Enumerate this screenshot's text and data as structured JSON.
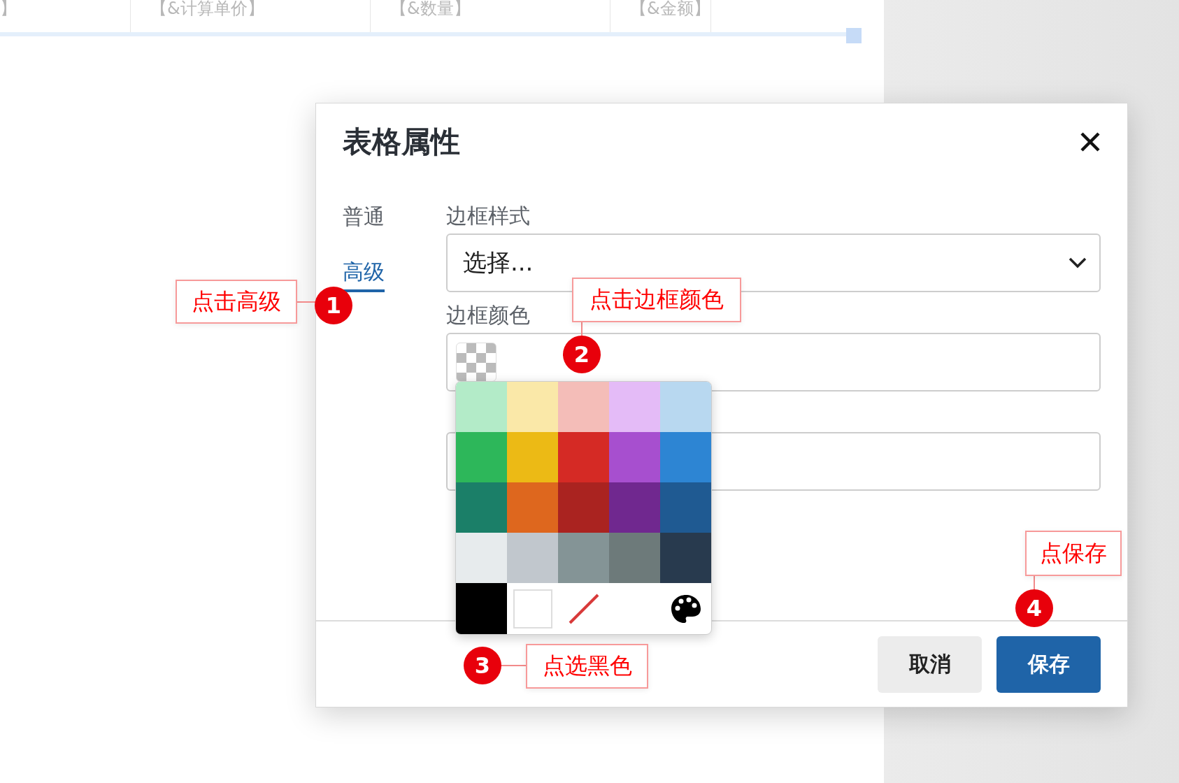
{
  "table_header": {
    "cells": [
      "】",
      "【&计算单价】",
      "【&数量】",
      "【&金额】"
    ]
  },
  "dialog": {
    "title": "表格属性",
    "tabs": [
      {
        "label": "普通",
        "selected": false
      },
      {
        "label": "高级",
        "selected": true
      }
    ],
    "fields": [
      {
        "kind": "select",
        "label": "边框样式",
        "value": "选择..."
      },
      {
        "kind": "color",
        "label": "边框颜色"
      },
      {
        "kind": "box"
      }
    ],
    "buttons": [
      {
        "label": "取消",
        "kind": "secondary"
      },
      {
        "label": "保存",
        "kind": "primary"
      }
    ]
  },
  "color_picker": {
    "swatches": [
      {
        "color": "#b3ebc8"
      },
      {
        "color": "#fae8a8"
      },
      {
        "color": "#f4bdb8"
      },
      {
        "color": "#e4bbf7"
      },
      {
        "color": "#b8d8f0"
      },
      {
        "color": "#2db75a"
      },
      {
        "color": "#ecba15"
      },
      {
        "color": "#d52a25"
      },
      {
        "color": "#a74fcf"
      },
      {
        "color": "#2d85d3"
      },
      {
        "color": "#1b7f68"
      },
      {
        "color": "#de671e"
      },
      {
        "color": "#aa2320"
      },
      {
        "color": "#70288f"
      },
      {
        "color": "#1f5a92"
      },
      {
        "color": "#e7ebed"
      },
      {
        "color": "#c1c7cd"
      },
      {
        "color": "#849496"
      },
      {
        "color": "#6d7a7a"
      },
      {
        "color": "#283a4e"
      }
    ],
    "extras": [
      {
        "kind": "swatch",
        "color": "#000000"
      },
      {
        "kind": "swatch",
        "color": "#ffffff"
      },
      {
        "kind": "none"
      },
      {
        "kind": "spacer"
      },
      {
        "kind": "custom"
      }
    ]
  },
  "annotations": [
    {
      "number": "1",
      "text": "点击高级"
    },
    {
      "number": "2",
      "text": "点击边框颜色"
    },
    {
      "number": "3",
      "text": "点选黑色"
    },
    {
      "number": "4",
      "text": "点保存"
    }
  ]
}
